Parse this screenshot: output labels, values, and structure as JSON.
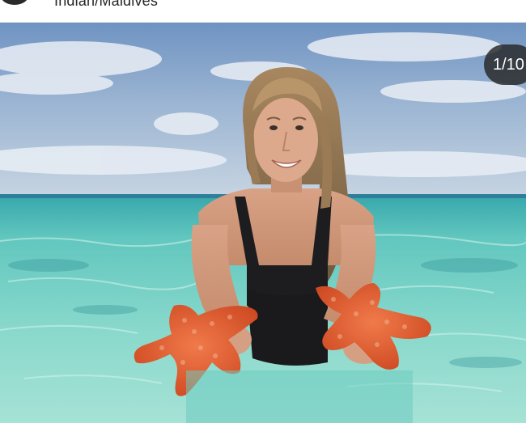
{
  "post": {
    "location": "Indian/Maldives"
  },
  "carousel": {
    "counter": "1/10"
  },
  "colors": {
    "sea": "#5fc8bc",
    "sky": "#8fb0d0",
    "starfish": "#e0572f",
    "counter_bg": "#262626"
  }
}
